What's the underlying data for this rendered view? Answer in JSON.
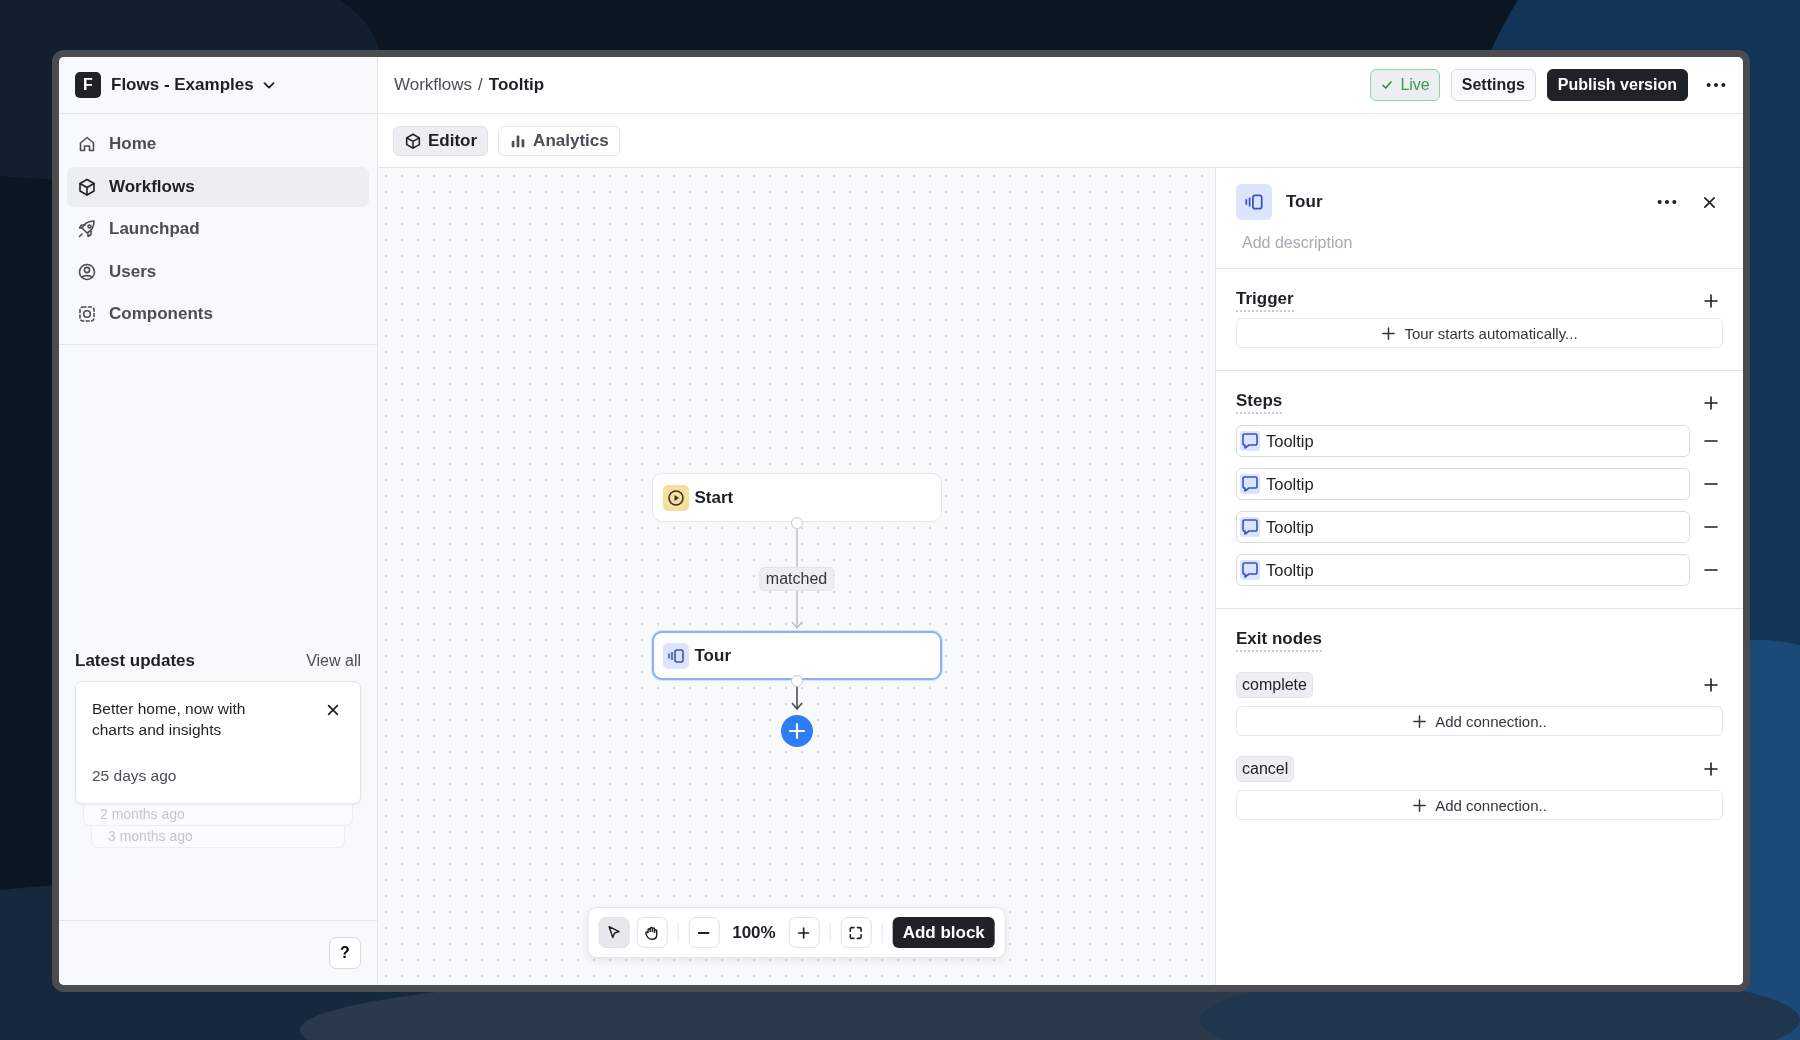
{
  "workspace": {
    "initial": "F",
    "name": "Flows - Examples"
  },
  "sidebar": {
    "items": [
      {
        "label": "Home",
        "kind": "home",
        "selected": false
      },
      {
        "label": "Workflows",
        "kind": "workflows",
        "selected": true
      },
      {
        "label": "Launchpad",
        "kind": "launchpad",
        "selected": false
      },
      {
        "label": "Users",
        "kind": "users",
        "selected": false
      },
      {
        "label": "Components",
        "kind": "components",
        "selected": false
      }
    ]
  },
  "updates": {
    "title": "Latest updates",
    "link": "View all",
    "card": {
      "text": "Better home, now with charts and insights",
      "time": "25 days ago"
    },
    "older": [
      "2 months ago",
      "3 months ago"
    ]
  },
  "help": "?",
  "breadcrumb": {
    "parent": "Workflows",
    "separator": "/",
    "current": "Tooltip"
  },
  "header": {
    "status": "Live",
    "settings": "Settings",
    "publish": "Publish version"
  },
  "view_tabs": [
    {
      "label": "Editor",
      "kind": "editor",
      "selected": true
    },
    {
      "label": "Analytics",
      "kind": "analytics",
      "selected": false
    }
  ],
  "canvas": {
    "nodes": [
      {
        "kind": "start",
        "label": "Start",
        "selected": false
      },
      {
        "kind": "tour",
        "label": "Tour",
        "selected": true
      }
    ],
    "edge_label": "matched"
  },
  "toolbar": {
    "tools": [
      {
        "kind": "pointer",
        "selected": true
      },
      {
        "kind": "hand",
        "selected": false
      }
    ],
    "zoom": "100%",
    "add": "Add block"
  },
  "panel": {
    "title": "Tour",
    "description_placeholder": "Add description",
    "trigger": {
      "title": "Trigger",
      "action": "Tour starts automatically..."
    },
    "steps": {
      "title": "Steps",
      "items": [
        "Tooltip",
        "Tooltip",
        "Tooltip",
        "Tooltip"
      ]
    },
    "exit": {
      "title": "Exit nodes",
      "items": [
        {
          "name": "complete",
          "action": "Add connection.."
        },
        {
          "name": "cancel",
          "action": "Add connection.."
        }
      ]
    }
  }
}
